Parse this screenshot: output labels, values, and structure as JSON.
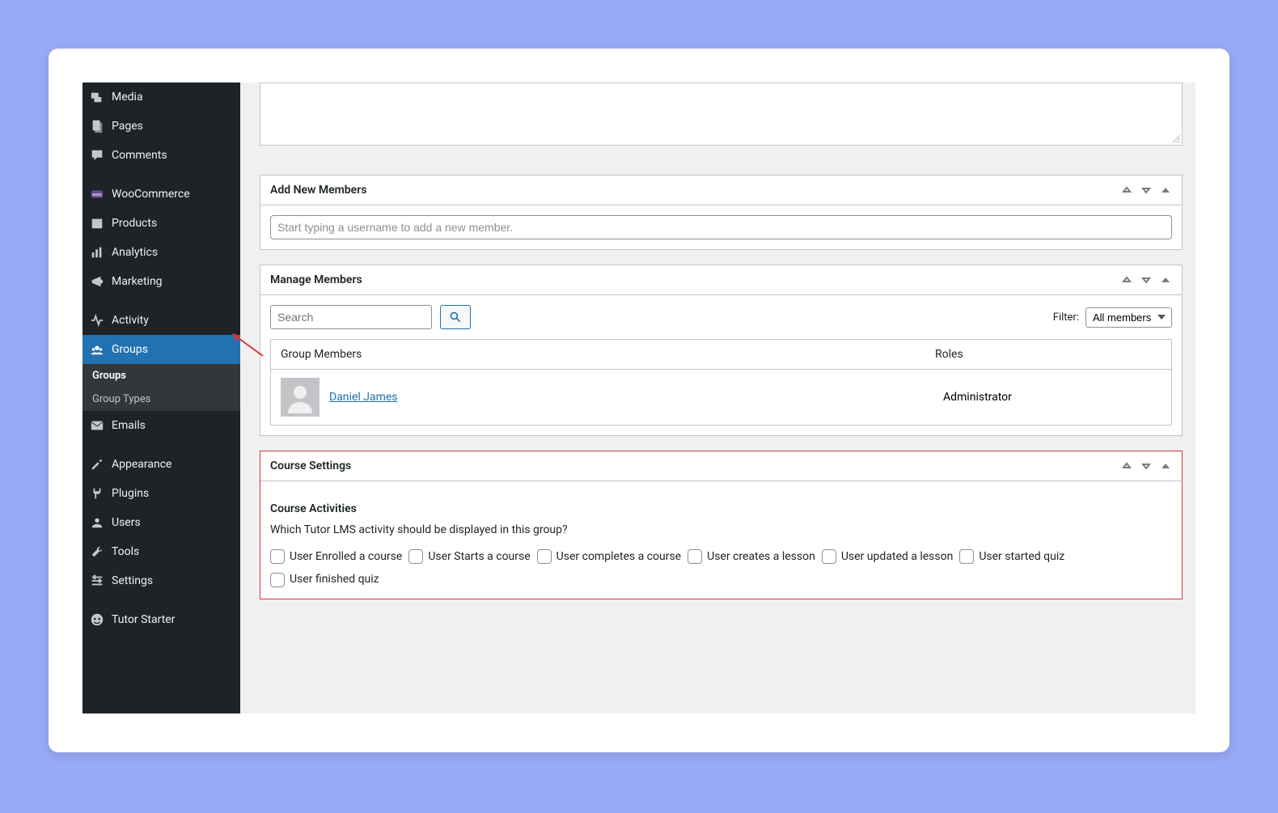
{
  "sidebar": {
    "items": [
      {
        "label": "Media",
        "icon": "media-icon"
      },
      {
        "label": "Pages",
        "icon": "pages-icon"
      },
      {
        "label": "Comments",
        "icon": "comments-icon"
      },
      {
        "label": "WooCommerce",
        "icon": "woo-icon"
      },
      {
        "label": "Products",
        "icon": "products-icon"
      },
      {
        "label": "Analytics",
        "icon": "analytics-icon"
      },
      {
        "label": "Marketing",
        "icon": "marketing-icon"
      },
      {
        "label": "Activity",
        "icon": "activity-icon"
      },
      {
        "label": "Groups",
        "icon": "groups-icon"
      },
      {
        "label": "Emails",
        "icon": "emails-icon"
      },
      {
        "label": "Appearance",
        "icon": "appearance-icon"
      },
      {
        "label": "Plugins",
        "icon": "plugins-icon"
      },
      {
        "label": "Users",
        "icon": "users-icon"
      },
      {
        "label": "Tools",
        "icon": "tools-icon"
      },
      {
        "label": "Settings",
        "icon": "settings-icon"
      },
      {
        "label": "Tutor Starter",
        "icon": "tutor-icon"
      }
    ],
    "submenu": {
      "items": [
        {
          "label": "Groups"
        },
        {
          "label": "Group Types"
        }
      ]
    }
  },
  "addMembers": {
    "title": "Add New Members",
    "placeholder": "Start typing a username to add a new member."
  },
  "manageMembers": {
    "title": "Manage Members",
    "searchPlaceholder": "Search",
    "filterLabel": "Filter:",
    "filterValue": "All members",
    "columns": {
      "c1": "Group Members",
      "c2": "Roles"
    },
    "rows": [
      {
        "name": "Daniel James",
        "role": "Administrator"
      }
    ]
  },
  "courseSettings": {
    "title": "Course Settings",
    "subTitle": "Course Activities",
    "question": "Which Tutor LMS activity should be displayed in this group?",
    "options": [
      "User Enrolled a course",
      "User Starts a course",
      "User completes a course",
      "User creates a lesson",
      "User updated a lesson",
      "User started quiz",
      "User finished quiz"
    ]
  }
}
